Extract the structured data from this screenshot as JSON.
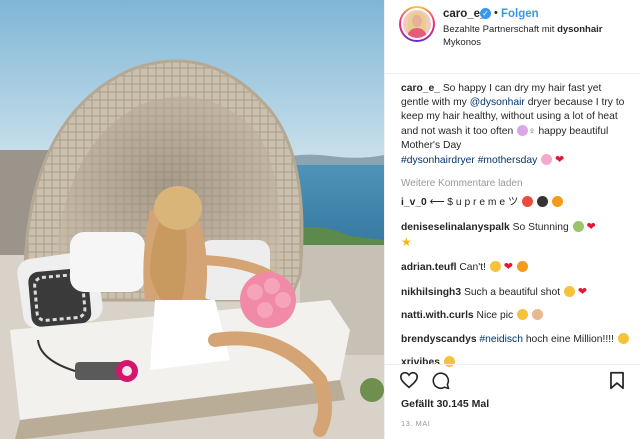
{
  "photo": {
    "description_icon": "photo-woman-wicker-daybed-sea"
  },
  "header": {
    "username": "caro_e_",
    "dot": "•",
    "follow_label": "Folgen",
    "partner_prefix": "Bezahlte Partnerschaft mit",
    "partner_brand": "dysonhair",
    "location": "Mykonos"
  },
  "caption": {
    "username": "caro_e_",
    "text1": "So happy I can dry my hair fast yet gentle with my",
    "mention": "@dysonhair",
    "text2": "dryer because I try to keep my hair healthy, without using a lot of heat and not wash it too often",
    "text3": "happy beautiful Mother's Day",
    "hashtags": "#dysonhairdryer #mothersday"
  },
  "load_more_label": "Weitere Kommentare laden",
  "comments": [
    {
      "username": "i_v_0",
      "text": "⟵ $ u p r e m e ツ"
    },
    {
      "username": "deniseselinalanyspalk",
      "text": "So Stunning"
    },
    {
      "username": "adrian.teufl",
      "text": "Can't!"
    },
    {
      "username": "nikhilsingh3",
      "text": "Such a beautiful shot"
    },
    {
      "username": "natti.with.curls",
      "text": "Nice pic"
    },
    {
      "username": "brendyscandys",
      "hashtag": "#neidisch",
      "text": "hoch eine Million!!!!"
    },
    {
      "username": "xrivibes",
      "text": ""
    }
  ],
  "likes_label": "Gefällt 30.145 Mal",
  "date_label": "13. MAI",
  "colors": {
    "accent": "#3897f0",
    "link": "#003569",
    "muted": "#999999",
    "heart": "#e3163a"
  }
}
